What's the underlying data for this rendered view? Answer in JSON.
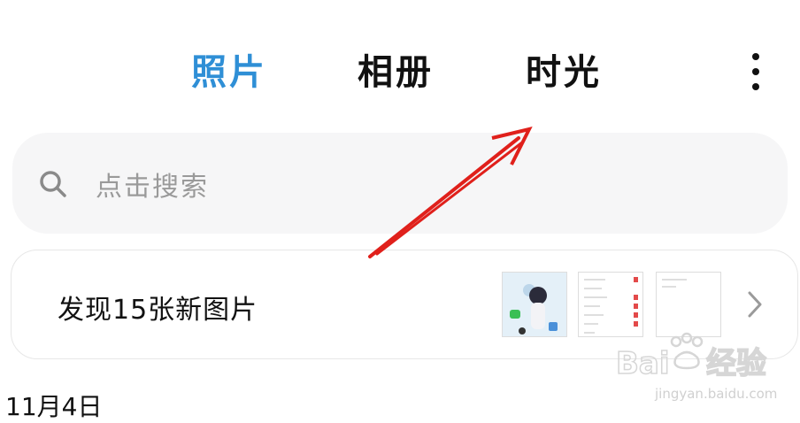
{
  "header": {
    "tabs": [
      {
        "label": "照片",
        "active": true
      },
      {
        "label": "相册",
        "active": false
      },
      {
        "label": "时光",
        "active": false
      }
    ],
    "more_icon": "more-vertical-icon"
  },
  "search": {
    "placeholder": "点击搜索",
    "icon": "search-icon"
  },
  "banner": {
    "text": "发现15张新图片",
    "chevron_icon": "chevron-right-icon"
  },
  "section": {
    "date": "11月4日"
  },
  "colors": {
    "active_tab": "#2f8fd6",
    "annotation_arrow": "#e0201b"
  },
  "watermark": {
    "brand": "Baidu经验",
    "url": "jingyan.baidu.com"
  }
}
